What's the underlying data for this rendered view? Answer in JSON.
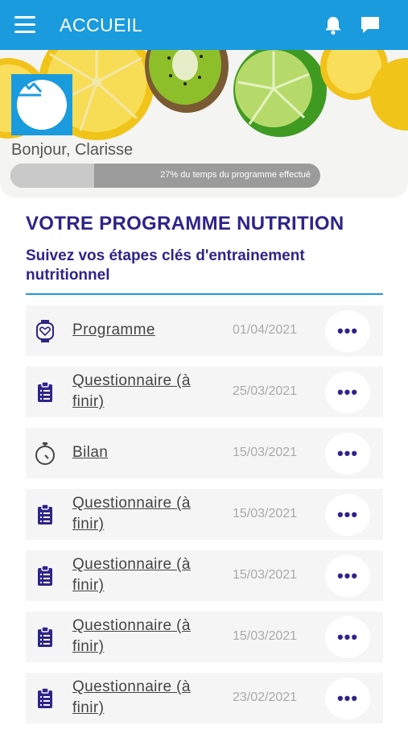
{
  "header": {
    "title": "ACCUEIL"
  },
  "hero": {
    "greeting": "Bonjour, Clarisse",
    "progress_text": "27% du temps du programme effectué",
    "progress_value": 0.27
  },
  "main": {
    "title": "VOTRE PROGRAMME NUTRITION",
    "subtitle": "Suivez vos étapes clés d'entrainement nutritionnel"
  },
  "steps": [
    {
      "label": "Programme",
      "date": "01/04/2021",
      "icon": "watch-heart-icon"
    },
    {
      "label": "Questionnaire (à finir)",
      "date": "25/03/2021",
      "icon": "clipboard-icon"
    },
    {
      "label": "Bilan",
      "date": "15/03/2021",
      "icon": "stopwatch-icon"
    },
    {
      "label": "Questionnaire (à finir)",
      "date": "15/03/2021",
      "icon": "clipboard-icon"
    },
    {
      "label": "Questionnaire (à finir)",
      "date": "15/03/2021",
      "icon": "clipboard-icon"
    },
    {
      "label": "Questionnaire (à finir)",
      "date": "15/03/2021",
      "icon": "clipboard-icon"
    },
    {
      "label": "Questionnaire (à finir)",
      "date": "23/02/2021",
      "icon": "clipboard-icon"
    }
  ],
  "more_glyph": "•••",
  "colors": {
    "header": "#1a9bde",
    "title": "#2e2489",
    "accent": "#1a9bde"
  }
}
